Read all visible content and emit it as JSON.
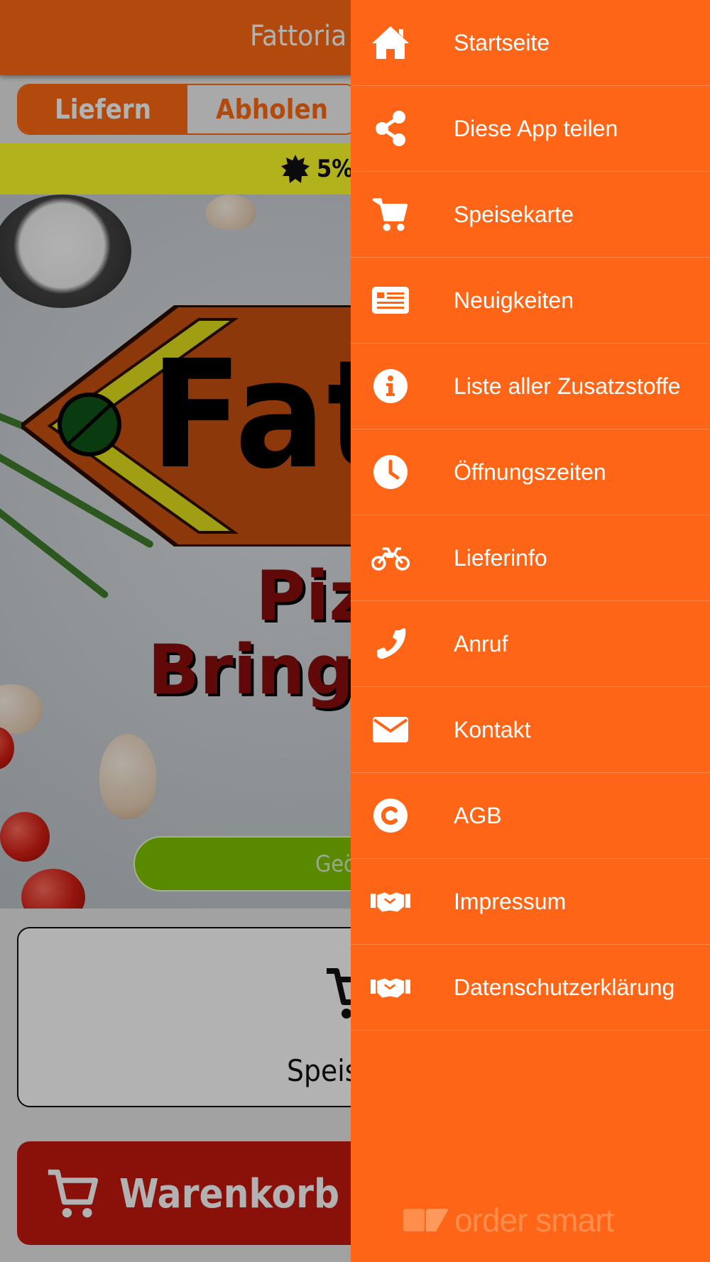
{
  "app": {
    "title": "Fattoria",
    "mode_toggle": {
      "deliver_label": "Liefern",
      "pickup_label": "Abholen",
      "selected": "Liefern"
    },
    "promo": {
      "text": "5%"
    },
    "hero": {
      "logo_title": "Fatt",
      "logo_line1": "Piz",
      "logo_line2": "Bringe",
      "status_text": "Geö"
    },
    "menu_card": {
      "label": "Speis",
      "icon": "cart-icon"
    },
    "cart_button": {
      "label": "Warenkorb",
      "icon": "cart-icon"
    }
  },
  "drawer": {
    "items": [
      {
        "label": "Startseite",
        "icon": "home-icon"
      },
      {
        "label": "Diese App teilen",
        "icon": "share-icon"
      },
      {
        "label": "Speisekarte",
        "icon": "cart-icon"
      },
      {
        "label": "Neuigkeiten",
        "icon": "newspaper-icon"
      },
      {
        "label": "Liste aller Zusatzstoffe",
        "icon": "info-icon"
      },
      {
        "label": "Öffnungszeiten",
        "icon": "clock-icon"
      },
      {
        "label": "Lieferinfo",
        "icon": "motorcycle-icon"
      },
      {
        "label": "Anruf",
        "icon": "phone-icon"
      },
      {
        "label": "Kontakt",
        "icon": "envelope-icon"
      },
      {
        "label": "AGB",
        "icon": "copyright-icon"
      },
      {
        "label": "Impressum",
        "icon": "handshake-icon"
      },
      {
        "label": "Datenschutzerklärung",
        "icon": "handshake-icon"
      }
    ],
    "brand": {
      "label": "order smart"
    }
  },
  "colors": {
    "drawer_bg": "#ff6517",
    "accent": "#ff6a13",
    "promo_bg": "#ffff2a",
    "cart_button": "#c6170f",
    "open_status": "#7fc400"
  }
}
